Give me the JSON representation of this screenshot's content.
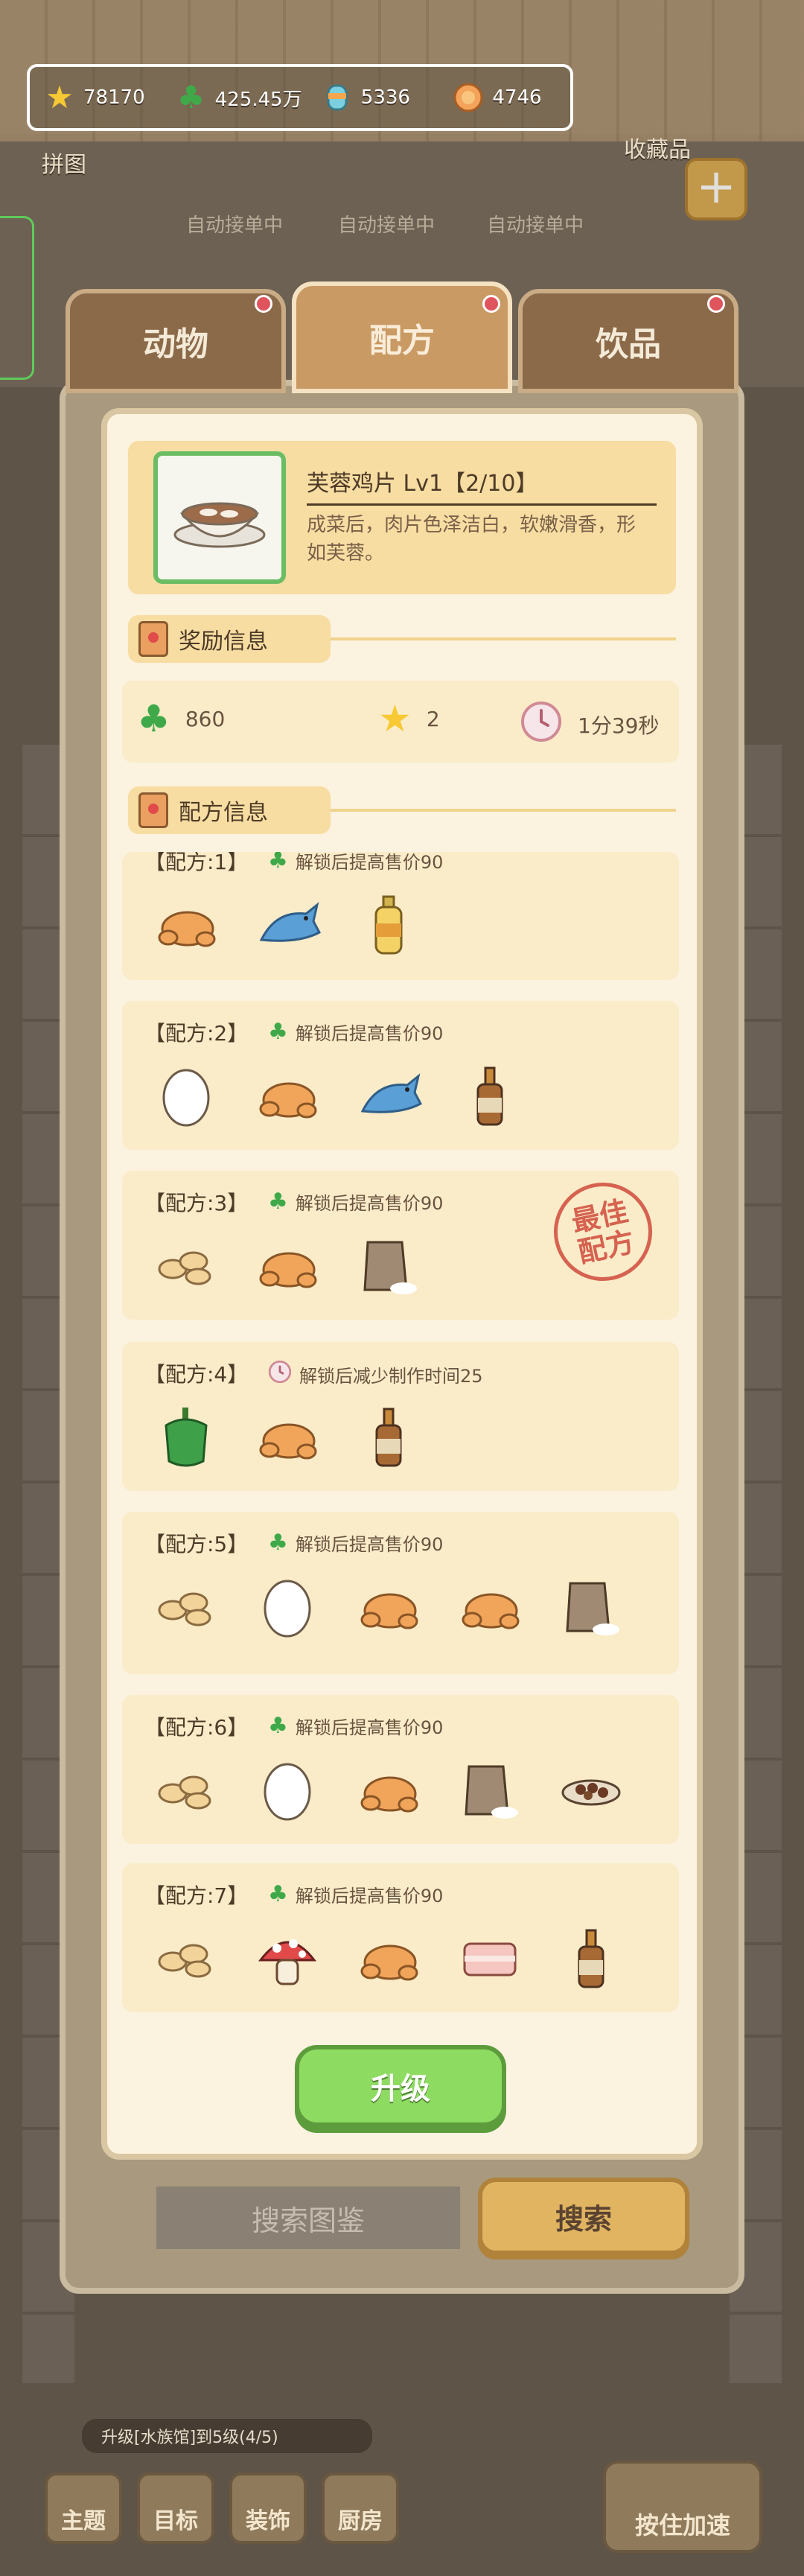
{
  "resources": [
    {
      "icon": "star-icon",
      "value": "78170"
    },
    {
      "icon": "clover-icon",
      "value": "425.45万"
    },
    {
      "icon": "candy-icon",
      "value": "5336"
    },
    {
      "icon": "coin-icon",
      "value": "4746"
    }
  ],
  "side": {
    "puzzle": "拼图",
    "collection": "收藏品"
  },
  "auto_orders": [
    "自动接单中",
    "自动接单中",
    "自动接单中"
  ],
  "tabs": [
    {
      "label": "动物"
    },
    {
      "label": "配方"
    },
    {
      "label": "饮品"
    }
  ],
  "dish": {
    "name": "芙蓉鸡片 Lv1【2/10】",
    "description": "成菜后，肉片色泽洁白，软嫩滑香，形如芙蓉。"
  },
  "sections": {
    "rewards": "奖励信息",
    "recipes": "配方信息"
  },
  "rewards": [
    {
      "icon": "clover-icon",
      "value": "860"
    },
    {
      "icon": "star-icon",
      "value": "2"
    },
    {
      "icon": "clock-icon",
      "value": "1分39秒"
    }
  ],
  "recipes": [
    {
      "title": "【配方:1】",
      "bonus_icon": "clover-icon",
      "bonus": "解锁后提高售价90",
      "ingredients": [
        "chicken-icon",
        "fish-icon",
        "oil-bottle-icon"
      ]
    },
    {
      "title": "【配方:2】",
      "bonus_icon": "clover-icon",
      "bonus": "解锁后提高售价90",
      "ingredients": [
        "egg-icon",
        "chicken-icon",
        "fish-icon",
        "sauce-bottle-icon"
      ]
    },
    {
      "title": "【配方:3】",
      "bonus_icon": "clover-icon",
      "bonus": "解锁后提高售价90",
      "ingredients": [
        "ginger-icon",
        "chicken-icon",
        "flour-bag-icon"
      ],
      "stamp": "最佳配方"
    },
    {
      "title": "【配方:4】",
      "bonus_icon": "clock-icon",
      "bonus": "解锁后减少制作时间25",
      "ingredients": [
        "pepper-icon",
        "chicken-icon",
        "sauce-bottle-icon"
      ]
    },
    {
      "title": "【配方:5】",
      "bonus_icon": "clover-icon",
      "bonus": "解锁后提高售价90",
      "ingredients": [
        "ginger-icon",
        "egg-icon",
        "chicken-icon",
        "chicken-icon",
        "flour-bag-icon"
      ]
    },
    {
      "title": "【配方:6】",
      "bonus_icon": "clover-icon",
      "bonus": "解锁后提高售价90",
      "ingredients": [
        "ginger-icon",
        "egg-icon",
        "chicken-icon",
        "flour-bag-icon",
        "beans-icon"
      ]
    },
    {
      "title": "【配方:7】",
      "bonus_icon": "clover-icon",
      "bonus": "解锁后提高售价90",
      "ingredients": [
        "ginger-icon",
        "mushroom-icon",
        "chicken-icon",
        "pork-icon",
        "sauce-bottle-icon"
      ]
    }
  ],
  "buttons": {
    "upgrade": "升级",
    "search_placeholder": "搜索图鉴",
    "search": "搜索"
  },
  "ticker": "升级[水族馆]到5级(4/5)",
  "nav": [
    "主题",
    "目标",
    "装饰",
    "厨房"
  ],
  "boost": "按住加速"
}
